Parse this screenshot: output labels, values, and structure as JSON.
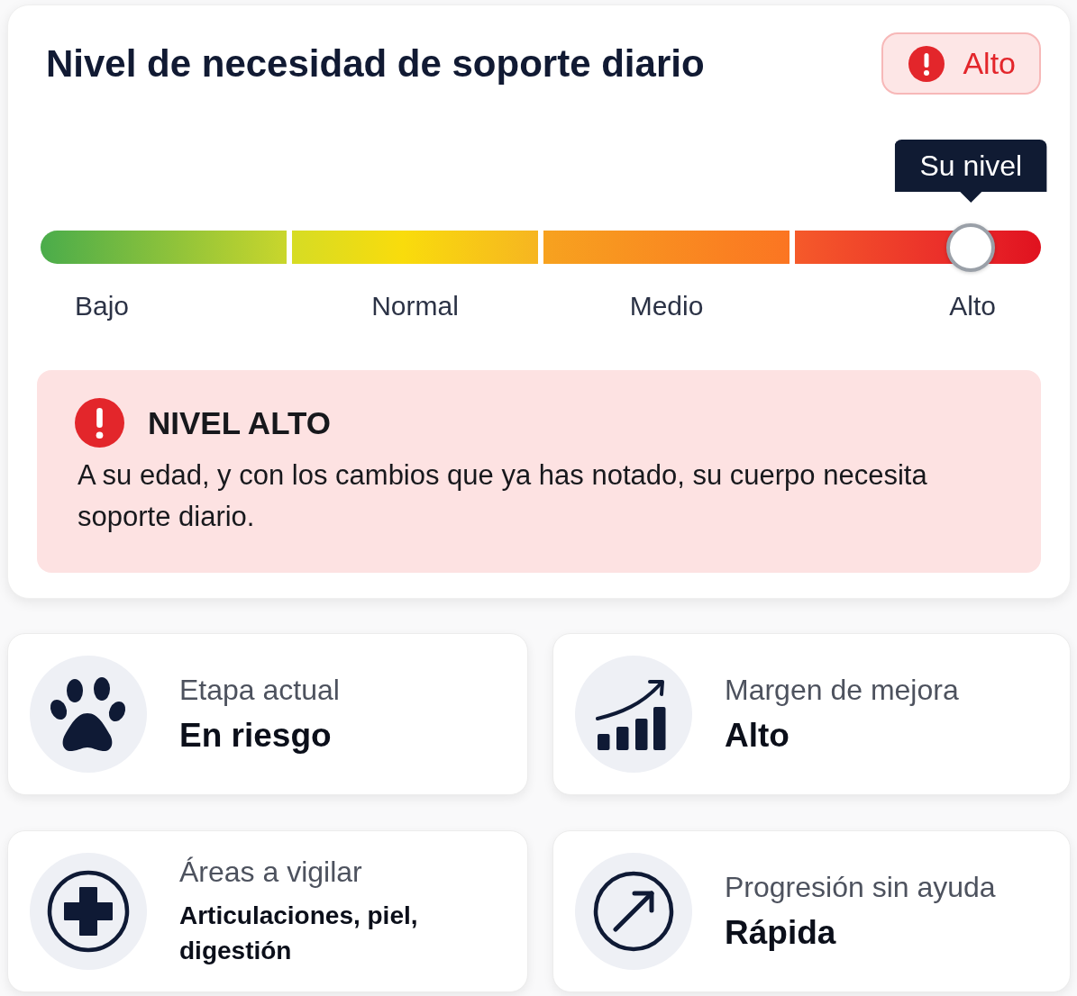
{
  "header": {
    "title": "Nivel de necesidad de soporte diario",
    "badge": "Alto"
  },
  "scale": {
    "level": 0.93,
    "marker": "Su nivel",
    "segments": [
      {
        "label": "Bajo"
      },
      {
        "label": "Normal"
      },
      {
        "label": "Medio"
      },
      {
        "label": "Alto"
      }
    ]
  },
  "alert": {
    "title": "NIVEL ALTO",
    "message": "A su edad, y con los cambios que ya has notado, su cuerpo necesita soporte diario."
  },
  "cards": [
    {
      "kind": "status",
      "label": "Etapa actual",
      "value": "En riesgo"
    },
    {
      "kind": "status",
      "label": "Margen de mejora",
      "value": "Alto"
    },
    {
      "kind": "list",
      "label": "Áreas a vigilar",
      "value": "Articulaciones, piel, digestión"
    },
    {
      "kind": "status",
      "label": "Progresión sin ayuda",
      "value": "Rápida"
    }
  ]
}
